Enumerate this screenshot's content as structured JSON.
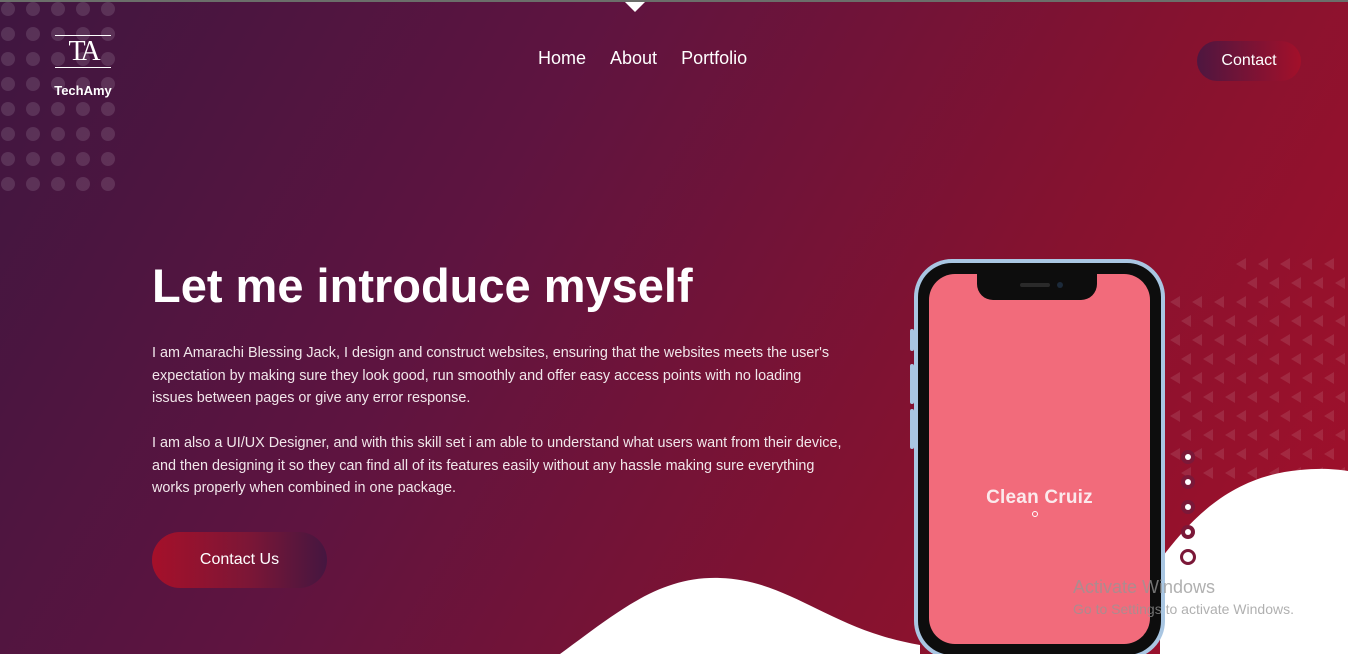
{
  "brand": {
    "monogram": "TA",
    "name": "TechAmy"
  },
  "nav": {
    "items": [
      {
        "label": "Home"
      },
      {
        "label": "About"
      },
      {
        "label": "Portfolio"
      }
    ]
  },
  "header": {
    "contact_label": "Contact"
  },
  "hero": {
    "title": "Let me introduce myself",
    "paragraph1": "I am Amarachi Blessing Jack, I design and construct websites, ensuring that the websites meets the user's expectation by making sure they look good, run smoothly and offer easy access points with no loading issues between pages or give any error response.",
    "paragraph2": "I am also a UI/UX Designer, and with this skill set i am able to understand what users want from their device, and then designing it so they can find all of its features easily without any hassle making sure everything works properly when combined in one package.",
    "cta_label": "Contact Us"
  },
  "phone": {
    "app_name": "Clean Cruiz"
  },
  "slider": {
    "count": 5,
    "active_index": 4
  },
  "watermark": {
    "line1": "Activate Windows",
    "line2": "Go to Settings to activate Windows."
  },
  "colors": {
    "gradient_start": "#3f1640",
    "gradient_end": "#a3102a",
    "phone_screen": "#f26b7b",
    "phone_frame": "#a9c6e2",
    "wave": "#ffffff"
  },
  "icons": [
    "dropdown-caret-icon",
    "slider-dot-icon"
  ]
}
